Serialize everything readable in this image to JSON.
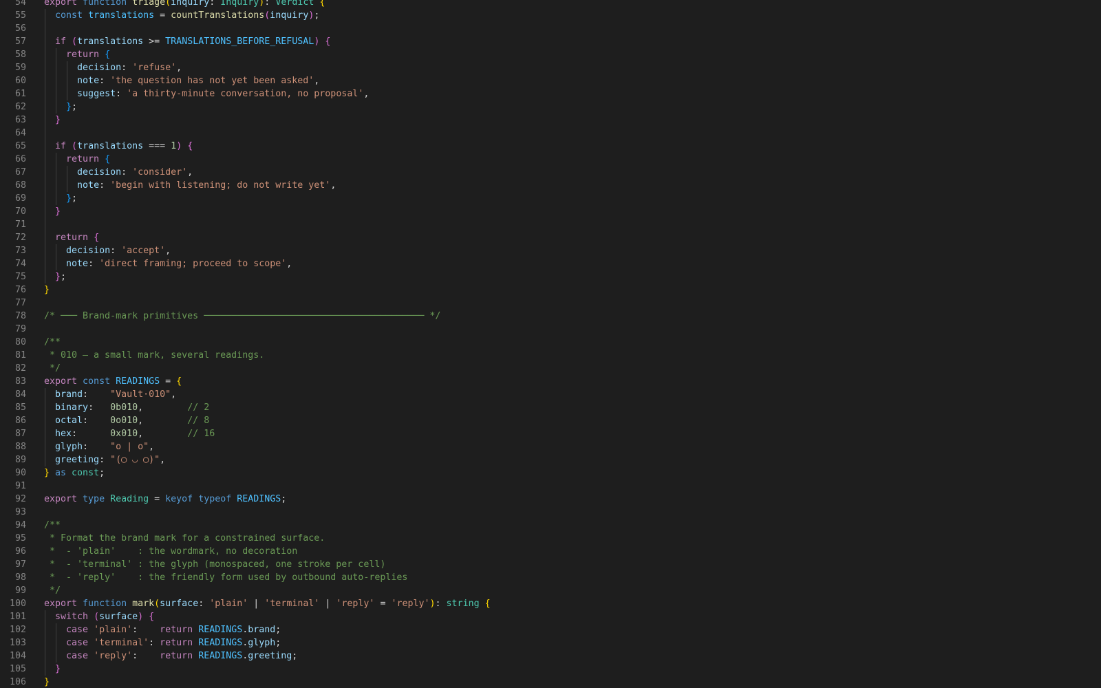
{
  "editor": {
    "language": "typescript",
    "first_line": 54,
    "colors": {
      "background": "#1e1e1e",
      "line_number": "#858585",
      "keyword": "#c586c0",
      "storage": "#569cd6",
      "function": "#dcdcaa",
      "string": "#ce9178",
      "number": "#b5cea8",
      "comment": "#6a9955",
      "type": "#4ec9b0",
      "variable": "#9cdcfe",
      "constant": "#4fc1ff",
      "bracket_1": "#ffd700",
      "bracket_2": "#da70d6",
      "bracket_3": "#179fff"
    },
    "lines": [
      {
        "n": "54",
        "tokens": [
          [
            "kw",
            "export "
          ],
          [
            "sk",
            "function "
          ],
          [
            "fn",
            "triage"
          ],
          [
            "b1",
            "("
          ],
          [
            "var",
            "inquiry"
          ],
          [
            "pun",
            ": "
          ],
          [
            "typ",
            "Inquiry"
          ],
          [
            "b1",
            ")"
          ],
          [
            "pun",
            ": "
          ],
          [
            "typ",
            "Verdict "
          ],
          [
            "b1",
            "{"
          ]
        ]
      },
      {
        "n": "55",
        "tokens": [
          [
            "pln",
            "  "
          ],
          [
            "sk",
            "const "
          ],
          [
            "con",
            "translations"
          ],
          [
            "pun",
            " = "
          ],
          [
            "fn",
            "countTranslations"
          ],
          [
            "b2",
            "("
          ],
          [
            "var",
            "inquiry"
          ],
          [
            "b2",
            ")"
          ],
          [
            "pun",
            ";"
          ]
        ]
      },
      {
        "n": "56",
        "tokens": []
      },
      {
        "n": "57",
        "tokens": [
          [
            "pln",
            "  "
          ],
          [
            "kw",
            "if "
          ],
          [
            "b2",
            "("
          ],
          [
            "var",
            "translations"
          ],
          [
            "pun",
            " >= "
          ],
          [
            "con",
            "TRANSLATIONS_BEFORE_REFUSAL"
          ],
          [
            "b2",
            ")"
          ],
          [
            "pun",
            " "
          ],
          [
            "b2",
            "{"
          ]
        ]
      },
      {
        "n": "58",
        "tokens": [
          [
            "pln",
            "    "
          ],
          [
            "kw",
            "return "
          ],
          [
            "b3",
            "{"
          ]
        ]
      },
      {
        "n": "59",
        "tokens": [
          [
            "pln",
            "      "
          ],
          [
            "var",
            "decision"
          ],
          [
            "pun",
            ": "
          ],
          [
            "str",
            "'refuse'"
          ],
          [
            "pun",
            ","
          ]
        ]
      },
      {
        "n": "60",
        "tokens": [
          [
            "pln",
            "      "
          ],
          [
            "var",
            "note"
          ],
          [
            "pun",
            ": "
          ],
          [
            "str",
            "'the question has not yet been asked'"
          ],
          [
            "pun",
            ","
          ]
        ]
      },
      {
        "n": "61",
        "tokens": [
          [
            "pln",
            "      "
          ],
          [
            "var",
            "suggest"
          ],
          [
            "pun",
            ": "
          ],
          [
            "str",
            "'a thirty-minute conversation, no proposal'"
          ],
          [
            "pun",
            ","
          ]
        ]
      },
      {
        "n": "62",
        "tokens": [
          [
            "pln",
            "    "
          ],
          [
            "b3",
            "}"
          ],
          [
            "pun",
            ";"
          ]
        ]
      },
      {
        "n": "63",
        "tokens": [
          [
            "pln",
            "  "
          ],
          [
            "b2",
            "}"
          ]
        ]
      },
      {
        "n": "64",
        "tokens": []
      },
      {
        "n": "65",
        "tokens": [
          [
            "pln",
            "  "
          ],
          [
            "kw",
            "if "
          ],
          [
            "b2",
            "("
          ],
          [
            "var",
            "translations"
          ],
          [
            "pun",
            " === "
          ],
          [
            "num",
            "1"
          ],
          [
            "b2",
            ")"
          ],
          [
            "pun",
            " "
          ],
          [
            "b2",
            "{"
          ]
        ]
      },
      {
        "n": "66",
        "tokens": [
          [
            "pln",
            "    "
          ],
          [
            "kw",
            "return "
          ],
          [
            "b3",
            "{"
          ]
        ]
      },
      {
        "n": "67",
        "tokens": [
          [
            "pln",
            "      "
          ],
          [
            "var",
            "decision"
          ],
          [
            "pun",
            ": "
          ],
          [
            "str",
            "'consider'"
          ],
          [
            "pun",
            ","
          ]
        ]
      },
      {
        "n": "68",
        "tokens": [
          [
            "pln",
            "      "
          ],
          [
            "var",
            "note"
          ],
          [
            "pun",
            ": "
          ],
          [
            "str",
            "'begin with listening; do not write yet'"
          ],
          [
            "pun",
            ","
          ]
        ]
      },
      {
        "n": "69",
        "tokens": [
          [
            "pln",
            "    "
          ],
          [
            "b3",
            "}"
          ],
          [
            "pun",
            ";"
          ]
        ]
      },
      {
        "n": "70",
        "tokens": [
          [
            "pln",
            "  "
          ],
          [
            "b2",
            "}"
          ]
        ]
      },
      {
        "n": "71",
        "tokens": []
      },
      {
        "n": "72",
        "tokens": [
          [
            "pln",
            "  "
          ],
          [
            "kw",
            "return "
          ],
          [
            "b2",
            "{"
          ]
        ]
      },
      {
        "n": "73",
        "tokens": [
          [
            "pln",
            "    "
          ],
          [
            "var",
            "decision"
          ],
          [
            "pun",
            ": "
          ],
          [
            "str",
            "'accept'"
          ],
          [
            "pun",
            ","
          ]
        ]
      },
      {
        "n": "74",
        "tokens": [
          [
            "pln",
            "    "
          ],
          [
            "var",
            "note"
          ],
          [
            "pun",
            ": "
          ],
          [
            "str",
            "'direct framing; proceed to scope'"
          ],
          [
            "pun",
            ","
          ]
        ]
      },
      {
        "n": "75",
        "tokens": [
          [
            "pln",
            "  "
          ],
          [
            "b2",
            "}"
          ],
          [
            "pun",
            ";"
          ]
        ]
      },
      {
        "n": "76",
        "tokens": [
          [
            "b1",
            "}"
          ]
        ]
      },
      {
        "n": "77",
        "tokens": []
      },
      {
        "n": "78",
        "tokens": [
          [
            "com",
            "/* ─── Brand-mark primitives ──────────────────────────────────────── */"
          ]
        ]
      },
      {
        "n": "79",
        "tokens": []
      },
      {
        "n": "80",
        "tokens": [
          [
            "com",
            "/**"
          ]
        ]
      },
      {
        "n": "81",
        "tokens": [
          [
            "com",
            " * 010 — a small mark, several readings."
          ]
        ]
      },
      {
        "n": "82",
        "tokens": [
          [
            "com",
            " */"
          ]
        ]
      },
      {
        "n": "83",
        "tokens": [
          [
            "kw",
            "export "
          ],
          [
            "sk",
            "const "
          ],
          [
            "con",
            "READINGS"
          ],
          [
            "pun",
            " = "
          ],
          [
            "b1",
            "{"
          ]
        ]
      },
      {
        "n": "84",
        "tokens": [
          [
            "pln",
            "  "
          ],
          [
            "var",
            "brand"
          ],
          [
            "pun",
            ":    "
          ],
          [
            "str",
            "\"Vault·010\""
          ],
          [
            "pun",
            ","
          ]
        ]
      },
      {
        "n": "85",
        "tokens": [
          [
            "pln",
            "  "
          ],
          [
            "var",
            "binary"
          ],
          [
            "pun",
            ":   "
          ],
          [
            "num",
            "0b010"
          ],
          [
            "pun",
            ",        "
          ],
          [
            "com",
            "// 2"
          ]
        ]
      },
      {
        "n": "86",
        "tokens": [
          [
            "pln",
            "  "
          ],
          [
            "var",
            "octal"
          ],
          [
            "pun",
            ":    "
          ],
          [
            "num",
            "0o010"
          ],
          [
            "pun",
            ",        "
          ],
          [
            "com",
            "// 8"
          ]
        ]
      },
      {
        "n": "87",
        "tokens": [
          [
            "pln",
            "  "
          ],
          [
            "var",
            "hex"
          ],
          [
            "pun",
            ":      "
          ],
          [
            "num",
            "0x010"
          ],
          [
            "pun",
            ",        "
          ],
          [
            "com",
            "// 16"
          ]
        ]
      },
      {
        "n": "88",
        "tokens": [
          [
            "pln",
            "  "
          ],
          [
            "var",
            "glyph"
          ],
          [
            "pun",
            ":    "
          ],
          [
            "str",
            "\"o | o\""
          ],
          [
            "pun",
            ","
          ]
        ]
      },
      {
        "n": "89",
        "tokens": [
          [
            "pln",
            "  "
          ],
          [
            "var",
            "greeting"
          ],
          [
            "pun",
            ": "
          ],
          [
            "str",
            "\"(◯ ◡ ◯)\""
          ],
          [
            "pun",
            ","
          ]
        ]
      },
      {
        "n": "90",
        "tokens": [
          [
            "b1",
            "}"
          ],
          [
            "sk",
            " as "
          ],
          [
            "typ",
            "const"
          ],
          [
            "pun",
            ";"
          ]
        ]
      },
      {
        "n": "91",
        "tokens": []
      },
      {
        "n": "92",
        "tokens": [
          [
            "kw",
            "export "
          ],
          [
            "sk",
            "type "
          ],
          [
            "typ",
            "Reading"
          ],
          [
            "pun",
            " = "
          ],
          [
            "sk",
            "keyof "
          ],
          [
            "sk",
            "typeof "
          ],
          [
            "con",
            "READINGS"
          ],
          [
            "pun",
            ";"
          ]
        ]
      },
      {
        "n": "93",
        "tokens": []
      },
      {
        "n": "94",
        "tokens": [
          [
            "com",
            "/**"
          ]
        ]
      },
      {
        "n": "95",
        "tokens": [
          [
            "com",
            " * Format the brand mark for a constrained surface."
          ]
        ]
      },
      {
        "n": "96",
        "tokens": [
          [
            "com",
            " *  - 'plain'    : the wordmark, no decoration"
          ]
        ]
      },
      {
        "n": "97",
        "tokens": [
          [
            "com",
            " *  - 'terminal' : the glyph (monospaced, one stroke per cell)"
          ]
        ]
      },
      {
        "n": "98",
        "tokens": [
          [
            "com",
            " *  - 'reply'    : the friendly form used by outbound auto-replies"
          ]
        ]
      },
      {
        "n": "99",
        "tokens": [
          [
            "com",
            " */"
          ]
        ]
      },
      {
        "n": "100",
        "tokens": [
          [
            "kw",
            "export "
          ],
          [
            "sk",
            "function "
          ],
          [
            "fn",
            "mark"
          ],
          [
            "b1",
            "("
          ],
          [
            "var",
            "surface"
          ],
          [
            "pun",
            ": "
          ],
          [
            "str",
            "'plain'"
          ],
          [
            "pun",
            " | "
          ],
          [
            "str",
            "'terminal'"
          ],
          [
            "pun",
            " | "
          ],
          [
            "str",
            "'reply'"
          ],
          [
            "pun",
            " = "
          ],
          [
            "str",
            "'reply'"
          ],
          [
            "b1",
            ")"
          ],
          [
            "pun",
            ": "
          ],
          [
            "typ",
            "string "
          ],
          [
            "b1",
            "{"
          ]
        ]
      },
      {
        "n": "101",
        "tokens": [
          [
            "pln",
            "  "
          ],
          [
            "kw",
            "switch "
          ],
          [
            "b2",
            "("
          ],
          [
            "var",
            "surface"
          ],
          [
            "b2",
            ")"
          ],
          [
            "pun",
            " "
          ],
          [
            "b2",
            "{"
          ]
        ]
      },
      {
        "n": "102",
        "tokens": [
          [
            "pln",
            "    "
          ],
          [
            "kw",
            "case "
          ],
          [
            "str",
            "'plain'"
          ],
          [
            "pun",
            ":    "
          ],
          [
            "kw",
            "return "
          ],
          [
            "con",
            "READINGS"
          ],
          [
            "pun",
            "."
          ],
          [
            "var",
            "brand"
          ],
          [
            "pun",
            ";"
          ]
        ]
      },
      {
        "n": "103",
        "tokens": [
          [
            "pln",
            "    "
          ],
          [
            "kw",
            "case "
          ],
          [
            "str",
            "'terminal'"
          ],
          [
            "pun",
            ": "
          ],
          [
            "kw",
            "return "
          ],
          [
            "con",
            "READINGS"
          ],
          [
            "pun",
            "."
          ],
          [
            "var",
            "glyph"
          ],
          [
            "pun",
            ";"
          ]
        ]
      },
      {
        "n": "104",
        "tokens": [
          [
            "pln",
            "    "
          ],
          [
            "kw",
            "case "
          ],
          [
            "str",
            "'reply'"
          ],
          [
            "pun",
            ":    "
          ],
          [
            "kw",
            "return "
          ],
          [
            "con",
            "READINGS"
          ],
          [
            "pun",
            "."
          ],
          [
            "var",
            "greeting"
          ],
          [
            "pun",
            ";"
          ]
        ]
      },
      {
        "n": "105",
        "tokens": [
          [
            "pln",
            "  "
          ],
          [
            "b2",
            "}"
          ]
        ]
      },
      {
        "n": "106",
        "tokens": [
          [
            "b1",
            "}"
          ]
        ]
      }
    ]
  }
}
